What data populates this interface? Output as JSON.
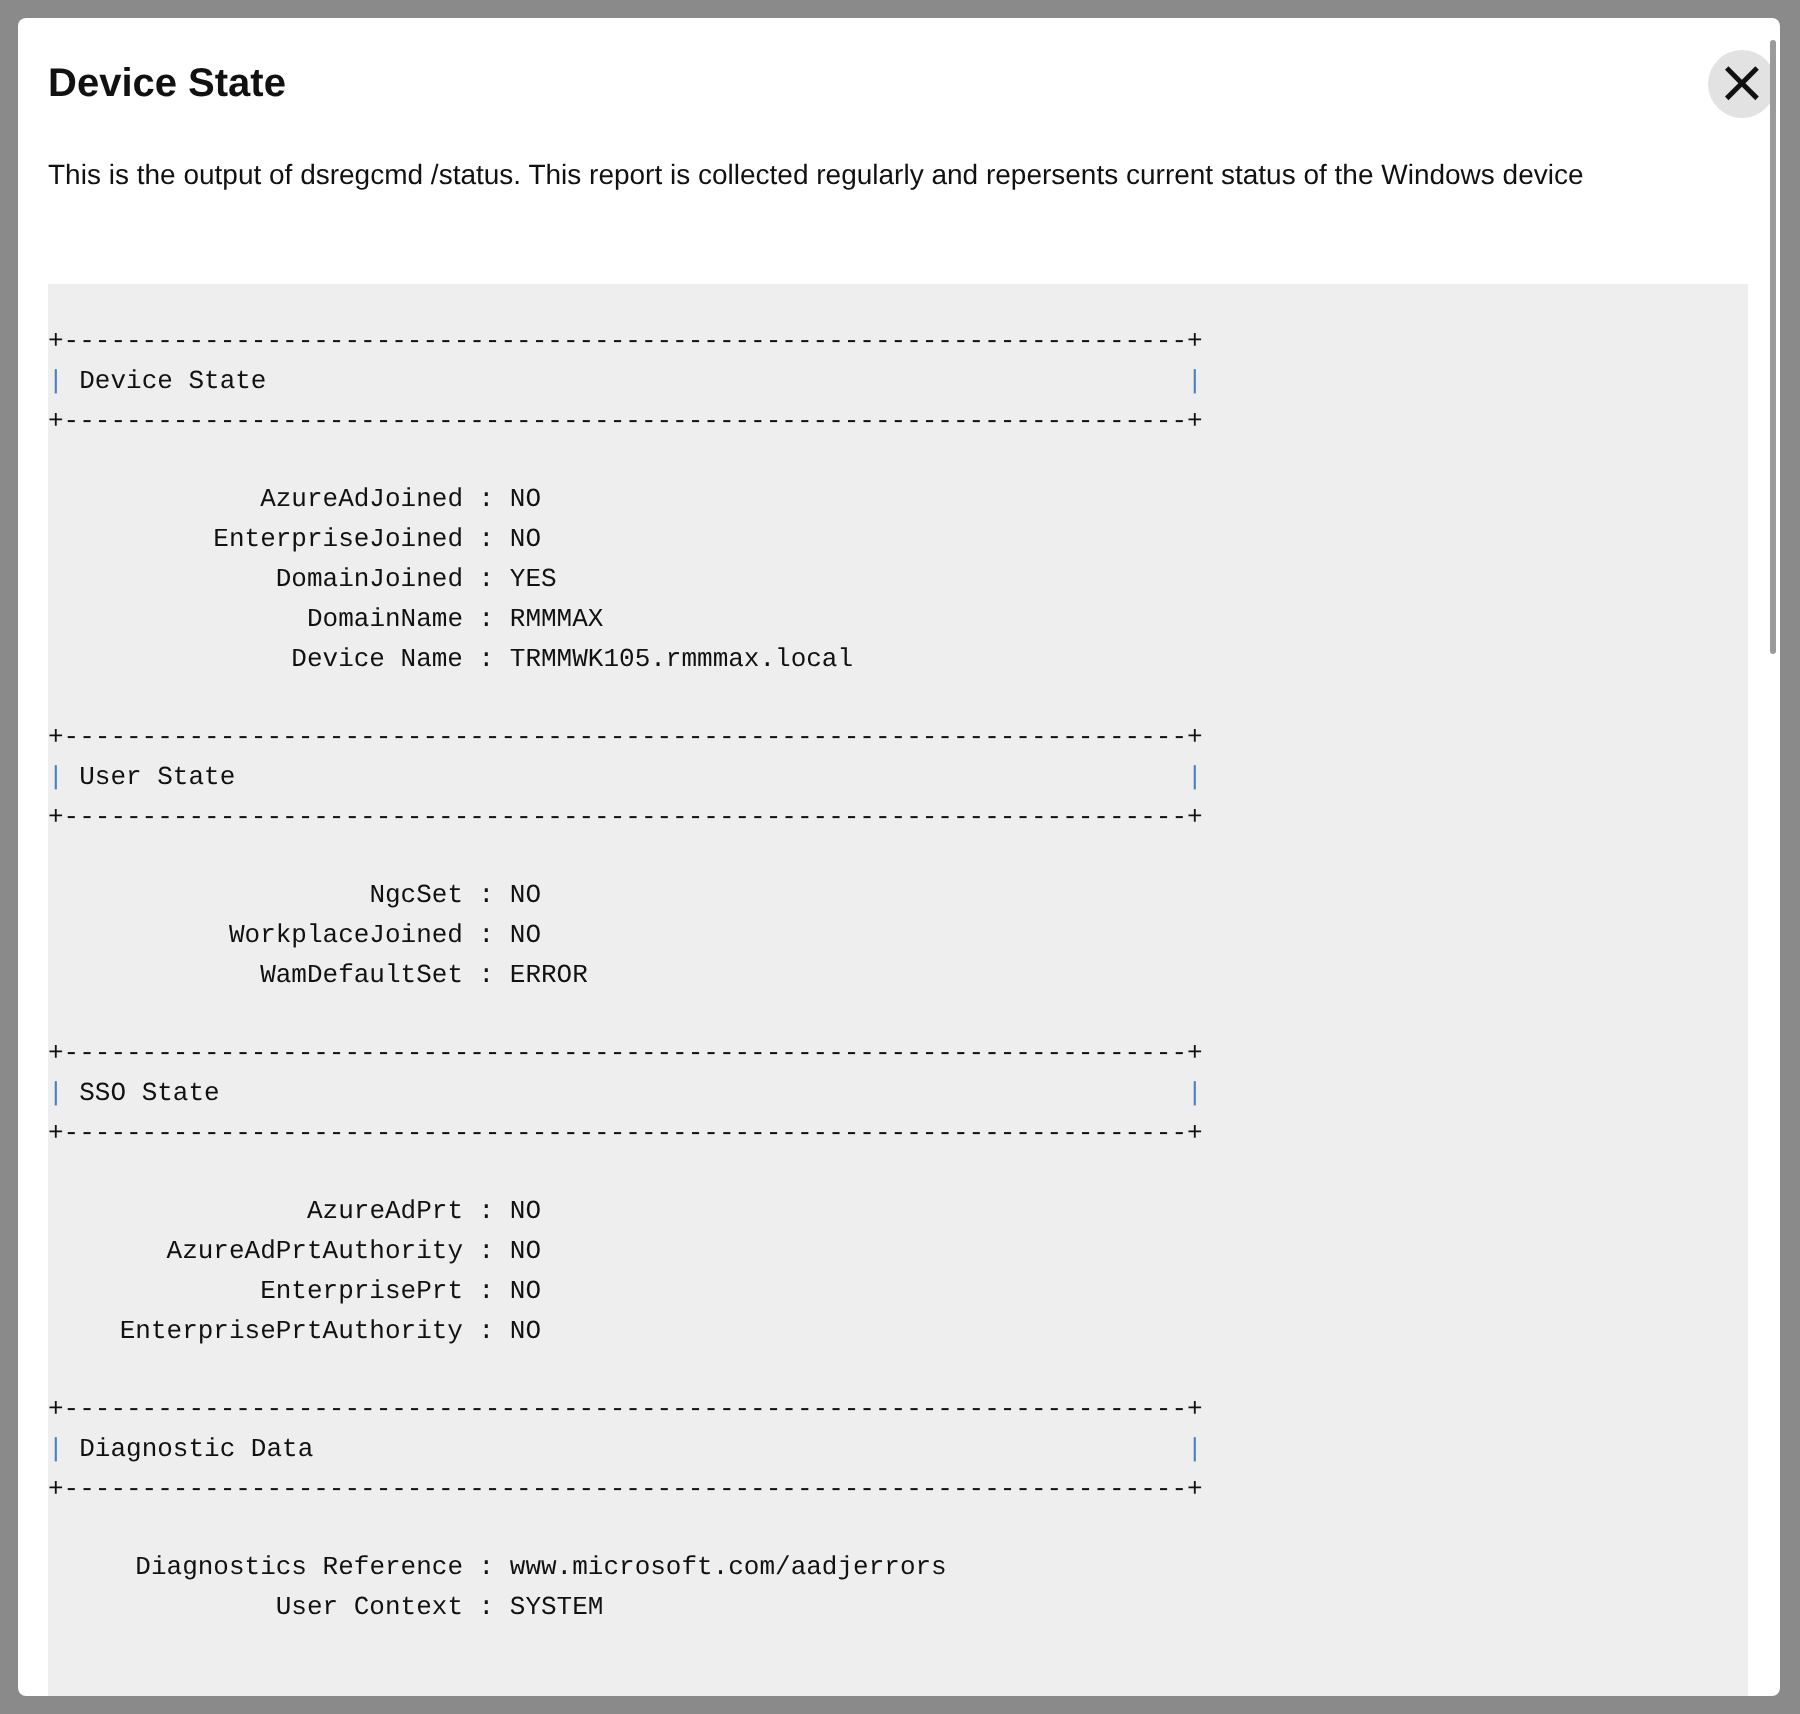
{
  "dialog": {
    "title": "Device State",
    "close_icon": "×",
    "description": "This is the output of dsregcmd /status. This report is collected regularly and repersents current status of the Windows device"
  },
  "report": {
    "sections": [
      {
        "rule_top": "+------------------------------------------------------------------------+",
        "edge_left": "|",
        "title": "Device State",
        "edge_right": "|",
        "rule_bottom": "+------------------------------------------------------------------------+",
        "rows": [
          {
            "key": "AzureAdJoined",
            "sep": ":",
            "value": "NO"
          },
          {
            "key": "EnterpriseJoined",
            "sep": ":",
            "value": "NO"
          },
          {
            "key": "DomainJoined",
            "sep": ":",
            "value": "YES"
          },
          {
            "key": "DomainName",
            "sep": ":",
            "value": "RMMMAX"
          },
          {
            "key": "Device Name",
            "sep": ":",
            "value": "TRMMWK105.rmmmax.local"
          }
        ]
      },
      {
        "rule_top": "+------------------------------------------------------------------------+",
        "edge_left": "|",
        "title": "User State",
        "edge_right": "|",
        "rule_bottom": "+------------------------------------------------------------------------+",
        "rows": [
          {
            "key": "NgcSet",
            "sep": ":",
            "value": "NO"
          },
          {
            "key": "WorkplaceJoined",
            "sep": ":",
            "value": "NO"
          },
          {
            "key": "WamDefaultSet",
            "sep": ":",
            "value": "ERROR"
          }
        ]
      },
      {
        "rule_top": "+------------------------------------------------------------------------+",
        "edge_left": "|",
        "title": "SSO State",
        "edge_right": "|",
        "rule_bottom": "+------------------------------------------------------------------------+",
        "rows": [
          {
            "key": "AzureAdPrt",
            "sep": ":",
            "value": "NO"
          },
          {
            "key": "AzureAdPrtAuthority",
            "sep": ":",
            "value": "NO"
          },
          {
            "key": "EnterprisePrt",
            "sep": ":",
            "value": "NO"
          },
          {
            "key": "EnterprisePrtAuthority",
            "sep": ":",
            "value": "NO"
          }
        ]
      },
      {
        "rule_top": "+------------------------------------------------------------------------+",
        "edge_left": "|",
        "title": "Diagnostic Data",
        "edge_right": "|",
        "rule_bottom": "+------------------------------------------------------------------------+",
        "rows": [
          {
            "key": "Diagnostics Reference",
            "sep": ":",
            "value": "www.microsoft.com/aadjerrors"
          },
          {
            "key": "User Context",
            "sep": ":",
            "value": "SYSTEM"
          }
        ]
      }
    ]
  }
}
